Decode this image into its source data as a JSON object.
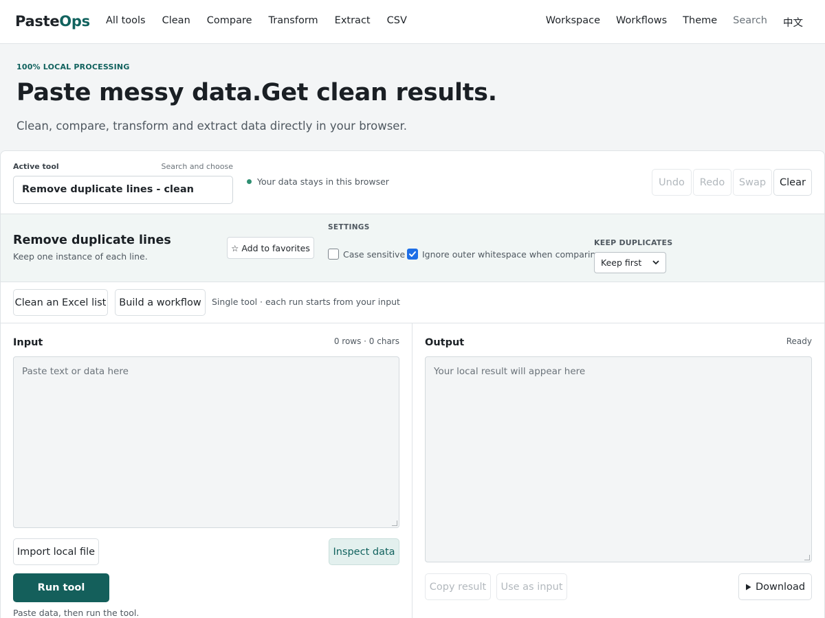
{
  "header": {
    "logo_part1": "Paste",
    "logo_part2": "Ops",
    "nav_left": [
      "All tools",
      "Clean",
      "Compare",
      "Transform",
      "Extract",
      "CSV"
    ],
    "nav_right": [
      "Workspace",
      "Workflows",
      "Theme",
      "Search",
      "中文"
    ]
  },
  "hero": {
    "eyebrow": "100% LOCAL PROCESSING",
    "title": "Paste messy data.Get clean results.",
    "subtitle": "Clean, compare, transform and extract data directly in your browser."
  },
  "tool_bar": {
    "active_label": "Active tool",
    "search_hint": "Search and choose",
    "selected_tool": "Remove duplicate lines - clean",
    "privacy_note": "Your data stays in this browser",
    "undo": "Undo",
    "redo": "Redo",
    "swap": "Swap",
    "clear": "Clear"
  },
  "tool_settings": {
    "name": "Remove duplicate lines",
    "description": "Keep one instance of each line.",
    "favorite_label": "☆ Add to favorites",
    "settings_heading": "SETTINGS",
    "case_sensitive_label": "Case sensitive",
    "case_sensitive": false,
    "ignore_whitespace_label": "Ignore outer whitespace when comparing",
    "ignore_whitespace": true,
    "keep_label": "KEEP DUPLICATES",
    "keep_value": "Keep first"
  },
  "shortcuts": {
    "excel": "Clean an Excel list",
    "workflow": "Build a workflow",
    "hint": "Single tool · each run starts from your input"
  },
  "input_panel": {
    "title": "Input",
    "meta": "0 rows · 0 chars",
    "placeholder": "Paste text or data here",
    "import": "Import local file",
    "inspect": "Inspect data",
    "run": "Run tool",
    "run_hint": "Paste data, then run the tool."
  },
  "output_panel": {
    "title": "Output",
    "status": "Ready",
    "placeholder": "Your local result will appear here",
    "copy": "Copy result",
    "use_as_input": "Use as input",
    "download": "Download"
  },
  "colors": {
    "brand": "#11625e",
    "checkbox": "#1d6ee6",
    "status_dot": "#2f8f72"
  }
}
